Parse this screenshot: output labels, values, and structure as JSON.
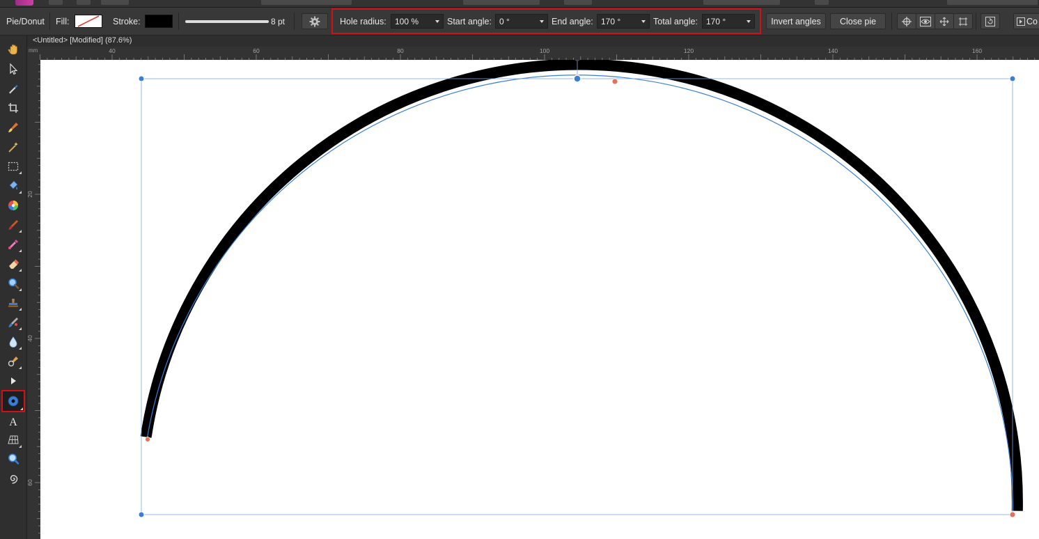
{
  "context_toolbar": {
    "tool_name": "Pie/Donut",
    "fill_label": "Fill:",
    "stroke_label": "Stroke:",
    "stroke_width": "8 pt",
    "hole_radius_label": "Hole radius:",
    "hole_radius_value": "100 %",
    "start_angle_label": "Start angle:",
    "start_angle_value": "0 °",
    "end_angle_label": "End angle:",
    "end_angle_value": "170 °",
    "total_angle_label": "Total angle:",
    "total_angle_value": "170 °",
    "invert_angles_label": "Invert angles",
    "close_pie_label": "Close pie",
    "partial_button_label": "Co"
  },
  "document": {
    "tab_title": "<Untitled> [Modified] (87.6%)"
  },
  "ruler": {
    "unit": "mm",
    "top_labels": [
      "40",
      "60",
      "80",
      "100",
      "120",
      "140",
      "160"
    ],
    "left_labels": [
      "20",
      "40",
      "60"
    ]
  },
  "tools": [
    {
      "name": "view-tool",
      "icon": "hand-icon"
    },
    {
      "name": "move-tool",
      "icon": "pointer-icon"
    },
    {
      "name": "node-tool",
      "icon": "pen-nib-icon"
    },
    {
      "name": "crop-tool",
      "icon": "crop-icon"
    },
    {
      "name": "brush-tool",
      "icon": "paint-brush-icon"
    },
    {
      "name": "selection-brush-tool",
      "icon": "magic-wand-icon"
    },
    {
      "name": "marquee-tool",
      "icon": "dotted-rect-icon"
    },
    {
      "name": "flood-fill-tool",
      "icon": "paint-bucket-icon"
    },
    {
      "name": "gradient-tool",
      "icon": "color-wheel-icon"
    },
    {
      "name": "paint-brush-tool",
      "icon": "brush-icon"
    },
    {
      "name": "color-picker-tool",
      "icon": "dropper-icon"
    },
    {
      "name": "erase-tool",
      "icon": "eraser-icon"
    },
    {
      "name": "zoom-lens-tool",
      "icon": "magnifier-icon"
    },
    {
      "name": "clone-tool",
      "icon": "stamp-icon"
    },
    {
      "name": "retouch-tool",
      "icon": "retouch-brush-icon"
    },
    {
      "name": "blur-tool",
      "icon": "water-drop-icon"
    },
    {
      "name": "dodge-tool",
      "icon": "dodge-icon"
    },
    {
      "name": "vector-tool",
      "icon": "play-arrow-icon"
    },
    {
      "name": "pie-donut-tool",
      "icon": "donut-icon",
      "active": true
    },
    {
      "name": "artistic-text-tool",
      "icon": "text-a-icon"
    },
    {
      "name": "mesh-warp-tool",
      "icon": "mesh-icon"
    },
    {
      "name": "zoom-tool",
      "icon": "zoom-icon"
    },
    {
      "name": "spiral-tool",
      "icon": "spiral-icon"
    }
  ],
  "colors": {
    "highlight": "#d0101a",
    "selection": "#3b7fd4",
    "handle": "#e0735a",
    "arc_stroke": "#000000"
  }
}
